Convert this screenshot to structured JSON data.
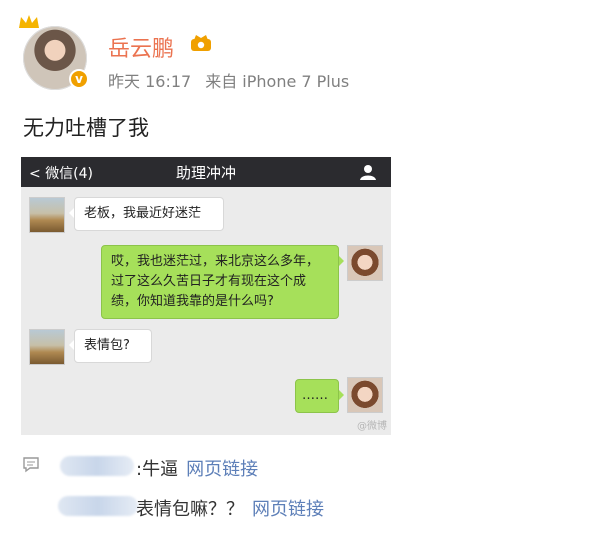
{
  "post": {
    "username": "岳云鹏",
    "time": "昨天 16:17",
    "source": "来自 iPhone 7 Plus",
    "text": "无力吐槽了我"
  },
  "chat": {
    "back_label": "微信(4)",
    "title": "助理冲冲",
    "messages": [
      {
        "side": "in",
        "text": "老板，我最近好迷茫"
      },
      {
        "side": "out",
        "text": "哎，我也迷茫过，来北京这么多年，过了这么久苦日子才有现在这个成绩，你知道我靠的是什么吗?"
      },
      {
        "side": "in",
        "text": "表情包?"
      },
      {
        "side": "out",
        "text": "……"
      }
    ],
    "watermark": "@微博"
  },
  "comments": [
    {
      "text": ":牛逼",
      "link": "网页链接"
    },
    {
      "text": "表情包嘛？？",
      "link": "网页链接"
    }
  ],
  "colors": {
    "username": "#eb7350",
    "link": "#5d7fb8",
    "bubble_out": "#a6e05a"
  }
}
